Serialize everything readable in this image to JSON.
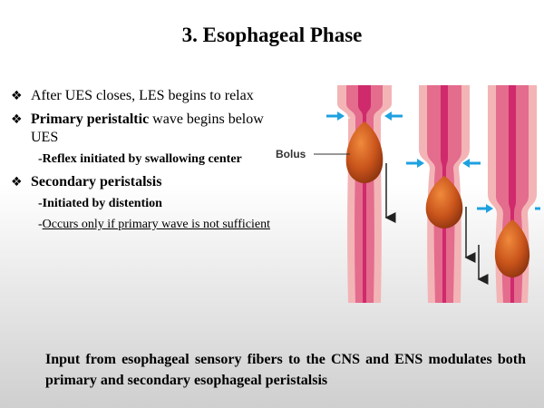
{
  "slide": {
    "title": "3. Esophageal Phase",
    "bullet_symbol": "❖",
    "bullets": [
      {
        "text": "After UES closes, LES begins to relax"
      },
      {
        "bold": "Primary peristaltic",
        "rest": " wave begins below UES",
        "subs": [
          {
            "text": "Reflex initiated by swallowing center"
          }
        ]
      },
      {
        "text": "Secondary peristalsis",
        "subs": [
          {
            "text": "Initiated by distention"
          },
          {
            "text": "Occurs only if primary wave is not sufficient"
          }
        ]
      }
    ],
    "sub_prefix": "-",
    "figure": {
      "label": "Bolus"
    },
    "footer": "Input from esophageal sensory fibers to the CNS and ENS modulates both primary and secondary esophageal peristalsis"
  },
  "colors": {
    "tube_outer": "#f3b4b6",
    "tube_wall": "#e46c8d",
    "lumen": "#cf2a6c",
    "bolus": "#c9541b",
    "arrow_blue": "#1ea1e0"
  }
}
